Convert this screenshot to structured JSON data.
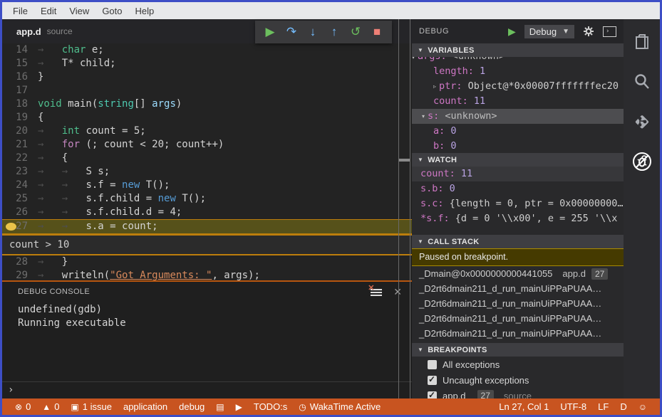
{
  "colors": {
    "accent_border": "#3D4EC6",
    "status_orange": "#C85420",
    "breakpoint_gold": "#E9C34A",
    "current_line_bg": "#56511A",
    "paused_gold_bg": "#453A00"
  },
  "menu": {
    "items": [
      "File",
      "Edit",
      "View",
      "Goto",
      "Help"
    ]
  },
  "tab": {
    "file": "app.d",
    "hint": "source"
  },
  "debug_toolbar": [
    {
      "name": "continue-button",
      "glyph": "▶",
      "cls": "tb-green"
    },
    {
      "name": "step-over-button",
      "glyph": "↷",
      "cls": "tb-blue"
    },
    {
      "name": "step-into-button",
      "glyph": "↓",
      "cls": "tb-blue"
    },
    {
      "name": "step-out-button",
      "glyph": "↑",
      "cls": "tb-blue"
    },
    {
      "name": "restart-button",
      "glyph": "↺",
      "cls": "tb-green"
    },
    {
      "name": "stop-button",
      "glyph": "■",
      "cls": "tb-red"
    }
  ],
  "editor": {
    "breakpoint_line": 27,
    "condition_widget": "count > 10",
    "lines": [
      {
        "num": 14,
        "tokens": [
          [
            "→   ",
            "ws"
          ],
          [
            "char",
            "kw"
          ],
          [
            " e;",
            "pl"
          ]
        ]
      },
      {
        "num": 15,
        "tokens": [
          [
            "→   ",
            "ws"
          ],
          [
            "T* child;",
            "pl"
          ]
        ]
      },
      {
        "num": 16,
        "tokens": [
          [
            "}",
            "pl"
          ]
        ]
      },
      {
        "num": 17,
        "tokens": []
      },
      {
        "num": 18,
        "tokens": [
          [
            "void",
            "kw"
          ],
          [
            " main(",
            "pl"
          ],
          [
            "string",
            "ty"
          ],
          [
            "[] ",
            "pl"
          ],
          [
            "args",
            "pb"
          ],
          [
            ")",
            "pl"
          ]
        ]
      },
      {
        "num": 19,
        "tokens": [
          [
            "{",
            "pl"
          ]
        ]
      },
      {
        "num": 20,
        "tokens": [
          [
            "→   ",
            "ws"
          ],
          [
            "int",
            "kw"
          ],
          [
            " count = 5;",
            "pl"
          ]
        ]
      },
      {
        "num": 21,
        "tokens": [
          [
            "→   ",
            "ws"
          ],
          [
            "for",
            "mg"
          ],
          [
            " (; count < 20; count++)",
            "pl"
          ]
        ]
      },
      {
        "num": 22,
        "tokens": [
          [
            "→   ",
            "ws"
          ],
          [
            "{",
            "pl"
          ]
        ]
      },
      {
        "num": 23,
        "tokens": [
          [
            "→   ",
            "ws"
          ],
          [
            "→   ",
            "ws"
          ],
          [
            "S s;",
            "pl"
          ]
        ]
      },
      {
        "num": 24,
        "tokens": [
          [
            "→   ",
            "ws"
          ],
          [
            "→   ",
            "ws"
          ],
          [
            "s.f = ",
            "pl"
          ],
          [
            "new",
            "bl"
          ],
          [
            " T();",
            "pl"
          ]
        ]
      },
      {
        "num": 25,
        "tokens": [
          [
            "→   ",
            "ws"
          ],
          [
            "→   ",
            "ws"
          ],
          [
            "s.f.child = ",
            "pl"
          ],
          [
            "new",
            "bl"
          ],
          [
            " T();",
            "pl"
          ]
        ]
      },
      {
        "num": 26,
        "tokens": [
          [
            "→   ",
            "ws"
          ],
          [
            "→   ",
            "ws"
          ],
          [
            "s.f.child.d = 4;",
            "pl"
          ]
        ]
      },
      {
        "num": 27,
        "tokens": [
          [
            "→   ",
            "ws"
          ],
          [
            "→   ",
            "ws"
          ],
          [
            "s.a = count;",
            "pl"
          ]
        ],
        "current": true
      },
      {
        "num": 28,
        "tokens": [
          [
            "→   ",
            "ws"
          ],
          [
            "}",
            "pl"
          ]
        ]
      },
      {
        "num": 29,
        "tokens": [
          [
            "→   ",
            "ws"
          ],
          [
            "writeln(",
            "pl"
          ],
          [
            "\"Got Arguments: \"",
            "st"
          ],
          [
            ", args);",
            "pl"
          ]
        ]
      }
    ]
  },
  "debug_console": {
    "title": "DEBUG CONSOLE",
    "output": [
      "undefined(gdb)",
      "Running executable"
    ],
    "prompt": "›"
  },
  "side_panel": {
    "header": {
      "title": "DEBUG",
      "config": "Debug"
    },
    "variables": {
      "title": "VARIABLES",
      "partial_row": {
        "name": "args",
        "value": "<unknown>"
      },
      "rows": [
        {
          "indent": 2,
          "name": "length",
          "value": "1",
          "vcls": "vnum"
        },
        {
          "indent": 2,
          "tw": "▹",
          "name": "ptr",
          "value": "Object@*0x00007fffffffec20",
          "vcls": "vplain"
        },
        {
          "indent": 2,
          "name": "count",
          "value": "11",
          "vcls": "vnum"
        },
        {
          "indent": 1,
          "tw": "▾",
          "name": "s",
          "value": "<unknown>",
          "vcls": "vgray",
          "sel": true
        },
        {
          "indent": 2,
          "name": "a",
          "value": "0",
          "vcls": "vnum"
        },
        {
          "indent": 2,
          "name": "b",
          "value": "0",
          "vcls": "vnum"
        }
      ]
    },
    "watch": {
      "title": "WATCH",
      "rows": [
        {
          "name": "count",
          "value": "11",
          "vcls": "vnum",
          "hl": true
        },
        {
          "name": "s.b",
          "value": "0",
          "vcls": "vnum"
        },
        {
          "name": "s.c",
          "value": "{length = 0, ptr = 0x00000000…",
          "vcls": "vplain"
        },
        {
          "name": "*s.f",
          "value": "{d = 0 '\\\\x00', e = 255 '\\\\x",
          "vcls": "vplain"
        }
      ]
    },
    "call_stack": {
      "title": "CALL STACK",
      "status": "Paused on breakpoint.",
      "frames": [
        {
          "label": "_Dmain@0x0000000000441055",
          "file": "app.d",
          "line": "27"
        },
        {
          "label": "_D2rt6dmain211_d_run_mainUiPPaPUAA…"
        },
        {
          "label": "_D2rt6dmain211_d_run_mainUiPPaPUAA…"
        },
        {
          "label": "_D2rt6dmain211_d_run_mainUiPPaPUAA…"
        },
        {
          "label": "_D2rt6dmain211_d_run_mainUiPPaPUAA…"
        }
      ]
    },
    "breakpoints": {
      "title": "BREAKPOINTS",
      "rows": [
        {
          "checked": false,
          "label": "All exceptions"
        },
        {
          "checked": true,
          "label": "Uncaught exceptions"
        },
        {
          "checked": true,
          "label": "app.d",
          "badge": "27",
          "hint": "source"
        }
      ]
    }
  },
  "activity_bar": [
    {
      "name": "files-icon"
    },
    {
      "name": "search-icon"
    },
    {
      "name": "git-icon"
    },
    {
      "name": "debug-icon",
      "active": true
    }
  ],
  "status_bar": {
    "left": [
      {
        "icon": "error-circle-icon",
        "glyph": "⊗",
        "text": "0"
      },
      {
        "icon": "warning-triangle-icon",
        "glyph": "▲",
        "text": "0"
      },
      {
        "icon": "issue-box-icon",
        "glyph": "▣",
        "text": "1 issue"
      },
      {
        "text": "application"
      },
      {
        "text": "debug"
      },
      {
        "icon": "file-icon",
        "glyph": "▤",
        "text": ""
      },
      {
        "icon": "play-icon",
        "glyph": "▶",
        "text": ""
      },
      {
        "text": "TODO:s"
      },
      {
        "icon": "clock-icon",
        "glyph": "◷",
        "text": "WakaTime Active"
      }
    ],
    "right": [
      {
        "text": "Ln 27, Col 1"
      },
      {
        "text": "UTF-8"
      },
      {
        "text": "LF"
      },
      {
        "text": "D"
      },
      {
        "icon": "smiley-icon",
        "glyph": "☺",
        "text": ""
      }
    ]
  }
}
